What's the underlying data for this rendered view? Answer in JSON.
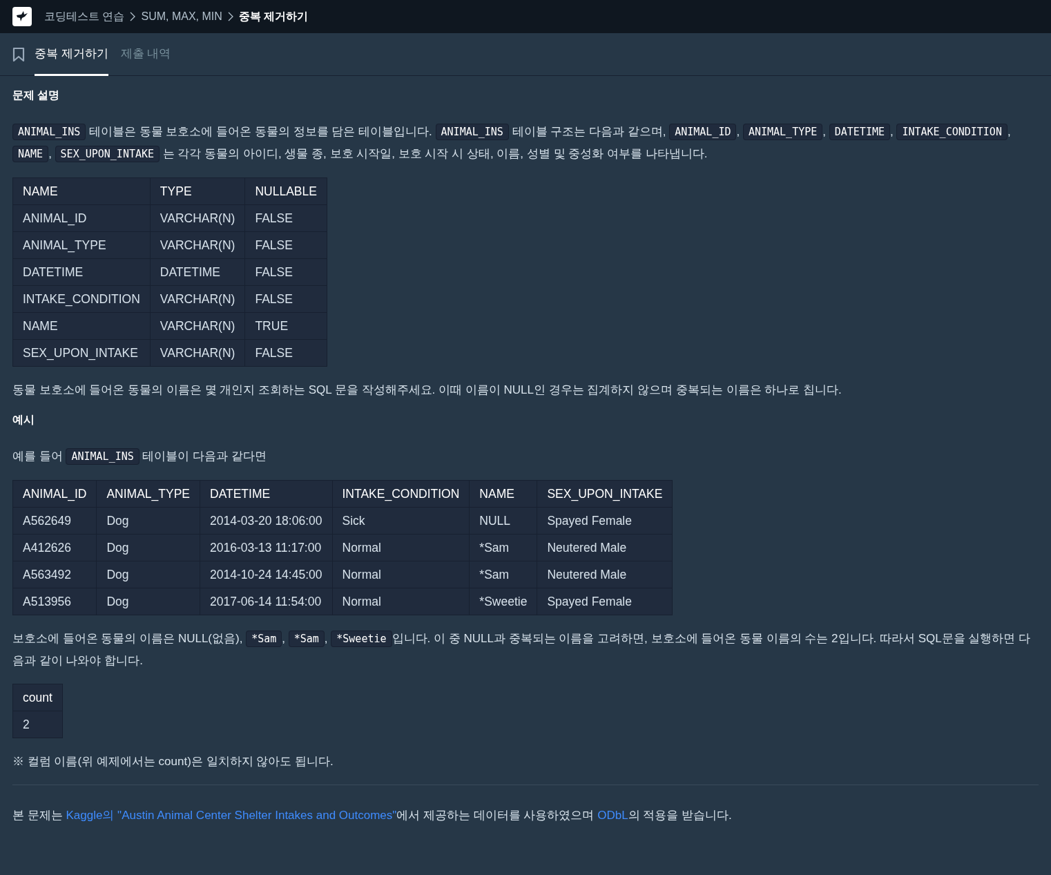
{
  "breadcrumb": [
    {
      "label": "코딩테스트 연습",
      "current": false
    },
    {
      "label": "SUM, MAX, MIN",
      "current": false
    },
    {
      "label": "중복 제거하기",
      "current": true
    }
  ],
  "tabs": [
    {
      "label": "중복 제거하기",
      "selected": true
    },
    {
      "label": "제출 내역",
      "selected": false
    }
  ],
  "content": [
    {
      "kind": "heading",
      "text": "문제 설명"
    },
    {
      "kind": "paragraph",
      "segments": [
        {
          "kind": "code",
          "text": "ANIMAL_INS"
        },
        {
          "kind": "text",
          "text": " 테이블은 동물 보호소에 들어온 동물의 정보를 담은 테이블입니다. "
        },
        {
          "kind": "code",
          "text": "ANIMAL_INS"
        },
        {
          "kind": "text",
          "text": " 테이블 구조는 다음과 같으며, "
        },
        {
          "kind": "code",
          "text": "ANIMAL_ID"
        },
        {
          "kind": "text",
          "text": ", "
        },
        {
          "kind": "code",
          "text": "ANIMAL_TYPE"
        },
        {
          "kind": "text",
          "text": ", "
        },
        {
          "kind": "code",
          "text": "DATETIME"
        },
        {
          "kind": "text",
          "text": ", "
        },
        {
          "kind": "code",
          "text": "INTAKE_CONDITION"
        },
        {
          "kind": "text",
          "text": ", "
        },
        {
          "kind": "code",
          "text": "NAME"
        },
        {
          "kind": "text",
          "text": ", "
        },
        {
          "kind": "code",
          "text": "SEX_UPON_INTAKE"
        },
        {
          "kind": "text",
          "text": " 는 각각 동물의 아이디, 생물 종, 보호 시작일, 보호 시작 시 상태, 이름, 성별 및 중성화 여부를 나타냅니다."
        }
      ]
    },
    {
      "kind": "table",
      "columns": [
        "NAME",
        "TYPE",
        "NULLABLE"
      ],
      "rows": [
        [
          "ANIMAL_ID",
          "VARCHAR(N)",
          "FALSE"
        ],
        [
          "ANIMAL_TYPE",
          "VARCHAR(N)",
          "FALSE"
        ],
        [
          "DATETIME",
          "DATETIME",
          "FALSE"
        ],
        [
          "INTAKE_CONDITION",
          "VARCHAR(N)",
          "FALSE"
        ],
        [
          "NAME",
          "VARCHAR(N)",
          "TRUE"
        ],
        [
          "SEX_UPON_INTAKE",
          "VARCHAR(N)",
          "FALSE"
        ]
      ]
    },
    {
      "kind": "paragraph",
      "segments": [
        {
          "kind": "text",
          "text": "동물 보호소에 들어온 동물의 이름은 몇 개인지 조회하는 SQL 문을 작성해주세요. 이때 이름이 NULL인 경우는 집계하지 않으며 중복되는 이름은 하나로 칩니다."
        }
      ]
    },
    {
      "kind": "heading",
      "text": "예시"
    },
    {
      "kind": "paragraph",
      "segments": [
        {
          "kind": "text",
          "text": "예를 들어 "
        },
        {
          "kind": "code",
          "text": "ANIMAL_INS"
        },
        {
          "kind": "text",
          "text": " 테이블이 다음과 같다면"
        }
      ]
    },
    {
      "kind": "table",
      "columns": [
        "ANIMAL_ID",
        "ANIMAL_TYPE",
        "DATETIME",
        "INTAKE_CONDITION",
        "NAME",
        "SEX_UPON_INTAKE"
      ],
      "rows": [
        [
          "A562649",
          "Dog",
          "2014-03-20 18:06:00",
          "Sick",
          "NULL",
          "Spayed Female"
        ],
        [
          "A412626",
          "Dog",
          "2016-03-13 11:17:00",
          "Normal",
          "*Sam",
          "Neutered Male"
        ],
        [
          "A563492",
          "Dog",
          "2014-10-24 14:45:00",
          "Normal",
          "*Sam",
          "Neutered Male"
        ],
        [
          "A513956",
          "Dog",
          "2017-06-14 11:54:00",
          "Normal",
          "*Sweetie",
          "Spayed Female"
        ]
      ]
    },
    {
      "kind": "paragraph",
      "segments": [
        {
          "kind": "text",
          "text": "보호소에 들어온 동물의 이름은 NULL(없음), "
        },
        {
          "kind": "code",
          "text": "*Sam"
        },
        {
          "kind": "text",
          "text": ", "
        },
        {
          "kind": "code",
          "text": "*Sam"
        },
        {
          "kind": "text",
          "text": ", "
        },
        {
          "kind": "code",
          "text": "*Sweetie"
        },
        {
          "kind": "text",
          "text": "입니다. 이 중 NULL과 중복되는 이름을 고려하면, 보호소에 들어온 동물 이름의 수는 2입니다. 따라서 SQL문을 실행하면 다음과 같이 나와야 합니다."
        }
      ]
    },
    {
      "kind": "table",
      "columns": [
        "count"
      ],
      "rows": [
        [
          "2"
        ]
      ]
    },
    {
      "kind": "paragraph",
      "segments": [
        {
          "kind": "text",
          "text": "※ 컬럼 이름(위 예제에서는 count)은 일치하지 않아도 됩니다."
        }
      ]
    },
    {
      "kind": "rule"
    },
    {
      "kind": "paragraph",
      "segments": [
        {
          "kind": "text",
          "text": "본 문제는 "
        },
        {
          "kind": "link",
          "text": "Kaggle의 \"Austin Animal Center Shelter Intakes and Outcomes\""
        },
        {
          "kind": "text",
          "text": "에서 제공하는 데이터를 사용하였으며 "
        },
        {
          "kind": "link",
          "text": "ODbL"
        },
        {
          "kind": "text",
          "text": "의 적용을 받습니다."
        }
      ]
    }
  ]
}
